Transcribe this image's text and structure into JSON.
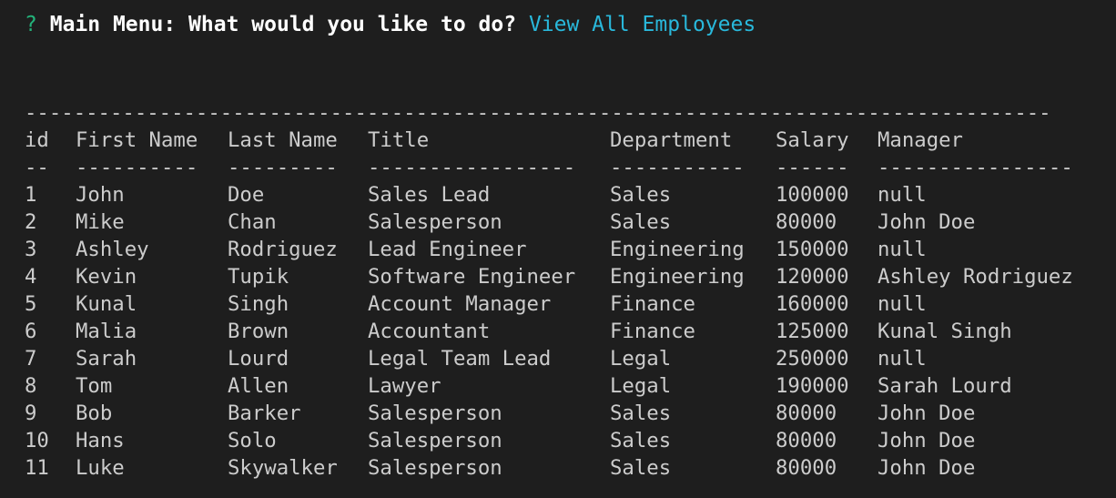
{
  "prompt": {
    "marker": "?",
    "question": "Main Menu: What would you like to do?",
    "answer": "View All Employees"
  },
  "divider_line": "------------------------------------------------------------------------------------",
  "table": {
    "headers": [
      "id",
      "First Name",
      "Last Name",
      "Title",
      "Department",
      "Salary",
      "Manager"
    ],
    "underlines": [
      "--",
      "----------",
      "---------",
      "-----------------",
      "-----------",
      "------",
      "----------------"
    ],
    "rows": [
      [
        "1",
        "John",
        "Doe",
        "Sales Lead",
        "Sales",
        "100000",
        "null"
      ],
      [
        "2",
        "Mike",
        "Chan",
        "Salesperson",
        "Sales",
        "80000",
        "John Doe"
      ],
      [
        "3",
        "Ashley",
        "Rodriguez",
        "Lead Engineer",
        "Engineering",
        "150000",
        "null"
      ],
      [
        "4",
        "Kevin",
        "Tupik",
        "Software Engineer",
        "Engineering",
        "120000",
        "Ashley Rodriguez"
      ],
      [
        "5",
        "Kunal",
        "Singh",
        "Account Manager",
        "Finance",
        "160000",
        "null"
      ],
      [
        "6",
        "Malia",
        "Brown",
        "Accountant",
        "Finance",
        "125000",
        "Kunal Singh"
      ],
      [
        "7",
        "Sarah",
        "Lourd",
        "Legal Team Lead",
        "Legal",
        "250000",
        "null"
      ],
      [
        "8",
        "Tom",
        "Allen",
        "Lawyer",
        "Legal",
        "190000",
        "Sarah Lourd"
      ],
      [
        "9",
        "Bob",
        "Barker",
        "Salesperson",
        "Sales",
        "80000",
        "John Doe"
      ],
      [
        "10",
        "Hans",
        "Solo",
        "Salesperson",
        "Sales",
        "80000",
        "John Doe"
      ],
      [
        "11",
        "Luke",
        "Skywalker",
        "Salesperson",
        "Sales",
        "80000",
        "John Doe"
      ]
    ]
  },
  "colors": {
    "background": "#1e1e1e",
    "text": "#cccccc",
    "marker": "#23b37a",
    "question": "#ffffff",
    "answer": "#29b8db"
  }
}
